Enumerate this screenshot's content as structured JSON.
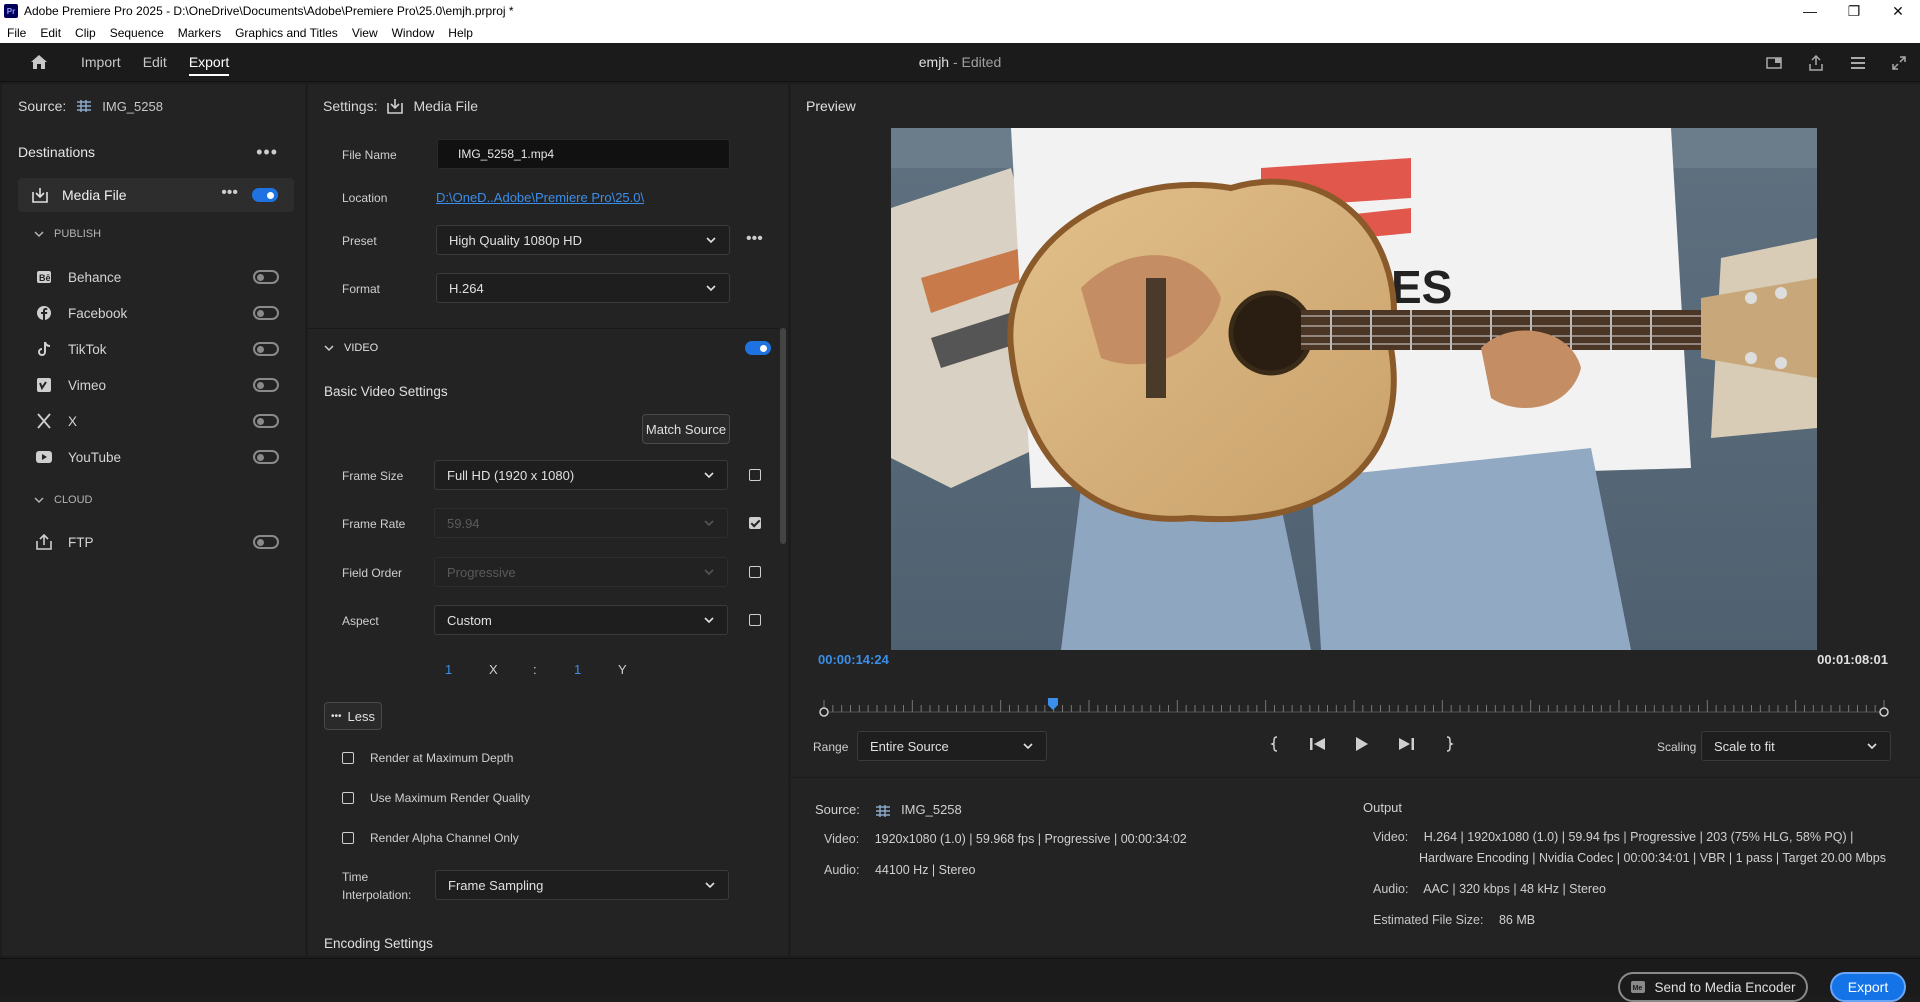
{
  "window": {
    "title": "Adobe Premiere Pro 2025 - D:\\OneDrive\\Documents\\Adobe\\Premiere Pro\\25.0\\emjh.prproj *",
    "controls": [
      "—",
      "❐",
      "✕"
    ]
  },
  "menu": [
    "File",
    "Edit",
    "Clip",
    "Sequence",
    "Markers",
    "Graphics and Titles",
    "View",
    "Window",
    "Help"
  ],
  "appbar": {
    "tabs": [
      "Import",
      "Edit",
      "Export"
    ],
    "active_tab": "Export",
    "project_name": "emjh",
    "project_status": "- Edited"
  },
  "left": {
    "source_label": "Source:",
    "source_value": "IMG_5258",
    "destinations_label": "Destinations",
    "media_file_label": "Media File",
    "media_file_enabled": true,
    "publish_label": "PUBLISH",
    "publish_items": [
      {
        "label": "Behance",
        "icon": "behance-icon"
      },
      {
        "label": "Facebook",
        "icon": "facebook-icon"
      },
      {
        "label": "TikTok",
        "icon": "tiktok-icon"
      },
      {
        "label": "Vimeo",
        "icon": "vimeo-icon"
      },
      {
        "label": "X",
        "icon": "x-icon"
      },
      {
        "label": "YouTube",
        "icon": "youtube-icon"
      }
    ],
    "cloud_label": "CLOUD",
    "cloud_items": [
      {
        "label": "FTP",
        "icon": "ftp-upload-icon"
      }
    ]
  },
  "settings": {
    "settings_label": "Settings:",
    "settings_value": "Media File",
    "file_name_label": "File Name",
    "file_name_value": "IMG_5258_1.mp4",
    "location_label": "Location",
    "location_value": "D:\\OneD..Adobe\\Premiere Pro\\25.0\\",
    "preset_label": "Preset",
    "preset_value": "High Quality 1080p HD",
    "format_label": "Format",
    "format_value": "H.264",
    "video_section": "VIDEO",
    "video_enabled": true,
    "basic_video_settings": "Basic Video Settings",
    "match_source": "Match Source",
    "frame_size_label": "Frame Size",
    "frame_size_value": "Full HD (1920 x 1080)",
    "frame_rate_label": "Frame Rate",
    "frame_rate_value": "59.94",
    "field_order_label": "Field Order",
    "field_order_value": "Progressive",
    "aspect_label": "Aspect",
    "aspect_value": "Custom",
    "aspect_x_value": "1",
    "aspect_x_label": "X",
    "aspect_sep": ":",
    "aspect_y_value": "1",
    "aspect_y_label": "Y",
    "less_button": "Less",
    "render_max_depth": "Render at Maximum Depth",
    "use_max_render_quality": "Use Maximum Render Quality",
    "render_alpha_only": "Render Alpha Channel Only",
    "time_interp_label_1": "Time",
    "time_interp_label_2": "Interpolation:",
    "time_interp_value": "Frame Sampling",
    "encoding_settings": "Encoding Settings"
  },
  "preview": {
    "label": "Preview",
    "current_time": "00:00:14:24",
    "duration": "00:01:08:01",
    "playhead_fraction": 0.216,
    "range_label": "Range",
    "range_value": "Entire Source",
    "scaling_label": "Scaling",
    "scaling_value": "Scale to fit"
  },
  "source_info": {
    "label": "Source:",
    "name": "IMG_5258",
    "video_key": "Video:",
    "video_value": "1920x1080 (1.0)  |  59.968 fps  |  Progressive  |  00:00:34:02",
    "audio_key": "Audio:",
    "audio_value": "44100 Hz  |  Stereo"
  },
  "output_info": {
    "label": "Output",
    "video_key": "Video:",
    "video_line1": "H.264  |  1920x1080 (1.0)  |  59.94 fps  |  Progressive  |  203 (75% HLG, 58% PQ)  |",
    "video_line2": "Hardware Encoding  |  Nvidia Codec  |  00:00:34:01  |  VBR  |  1 pass  |  Target 20.00 Mbps",
    "audio_key": "Audio:",
    "audio_value": "AAC  |  320 kbps  |  48 kHz  |  Stereo",
    "size_key": "Estimated File Size:",
    "size_value": "86 MB"
  },
  "footer": {
    "send_to_encoder": "Send to Media Encoder",
    "export": "Export"
  },
  "colors": {
    "accent": "#1473e6",
    "link": "#3b8eea",
    "panel": "#232323"
  }
}
